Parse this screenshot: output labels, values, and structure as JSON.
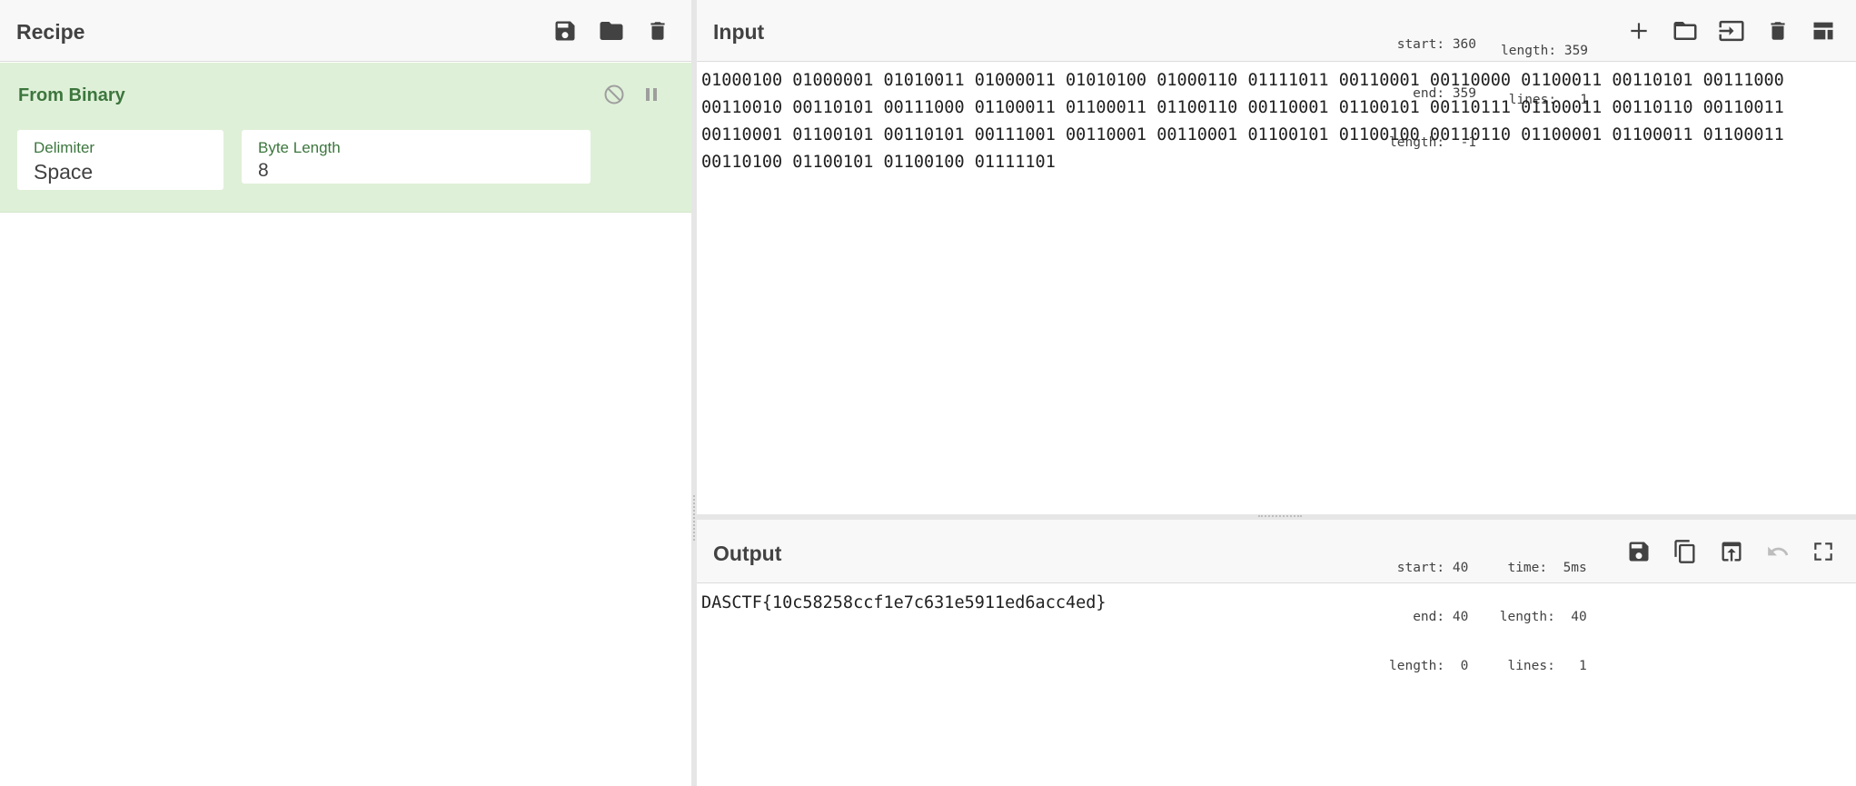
{
  "recipe": {
    "title": "Recipe",
    "operation": {
      "name": "From Binary",
      "fields": [
        {
          "label": "Delimiter",
          "value": "Space"
        },
        {
          "label": "Byte Length",
          "value": "8"
        }
      ]
    }
  },
  "input": {
    "title": "Input",
    "stats": {
      "start": "start: 360",
      "end": "  end: 359",
      "length_sel": "length:  -1",
      "length": "length: 359",
      "lines": " lines:   1"
    },
    "text": "01000100 01000001 01010011 01000011 01010100 01000110 01111011 00110001 00110000 01100011 00110101 00111000 00110010 00110101 00111000 01100011 01100011 01100110 00110001 01100101 00110111 01100011 00110110 00110011 00110001 01100101 00110101 00111001 00110001 00110001 01100101 01100100 00110110 01100001 01100011 01100011 00110100 01100101 01100100 01111101"
  },
  "output": {
    "title": "Output",
    "stats": {
      "start": "start: 40",
      "end": "  end: 40",
      "length_sel": "length:  0",
      "time": "  time:  5ms",
      "length": "length:  40",
      "lines": " lines:   1"
    },
    "text": "DASCTF{10c58258ccf1e7c631e5911ed6acc4ed}"
  },
  "colors": {
    "operation_bg": "#dff0d8",
    "operation_text": "#3c763d",
    "header_bg": "#f8f8f8",
    "disabled_icon": "#bdbdbd"
  }
}
